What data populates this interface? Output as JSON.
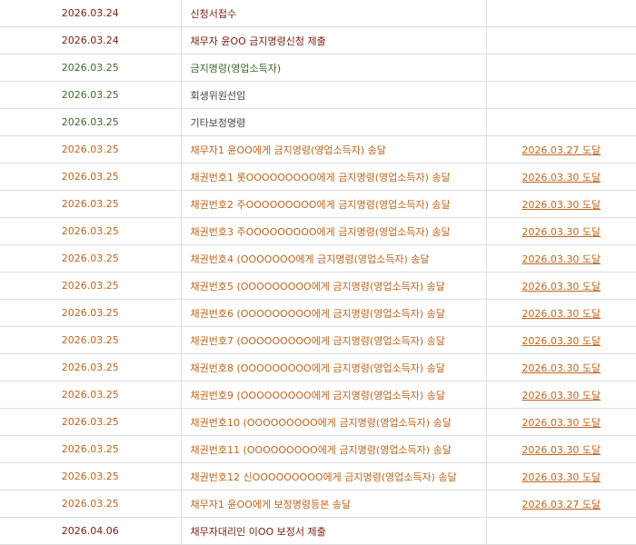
{
  "colors": {
    "dark_red": "#7a1e12",
    "green": "#3d6b2a",
    "gray_text": "#444444",
    "orange": "#c0651c",
    "border": "#dedede"
  },
  "rows": [
    {
      "date": "2026.03.24",
      "content": "신청서접수",
      "result": "",
      "style": "dark"
    },
    {
      "date": "2026.03.24",
      "content": "채무자 윤OO 금지명령신청 제출",
      "result": "",
      "style": "dark"
    },
    {
      "date": "2026.03.25",
      "content": "금지명령(영업소득자)",
      "result": "",
      "style": "green"
    },
    {
      "date": "2026.03.25",
      "content": "회생위원선임",
      "result": "",
      "style": "gray"
    },
    {
      "date": "2026.03.25",
      "content": "기타보정명령",
      "result": "",
      "style": "gray"
    },
    {
      "date": "2026.03.25",
      "content": "채무자1 윤OO에게 금지명령(영업소득자) 송달",
      "result": "2026.03.27 도달",
      "style": "orange"
    },
    {
      "date": "2026.03.25",
      "content": "채권번호1 롯OOOOOOOOO에게 금지명령(영업소득자) 송달",
      "result": "2026.03.30 도달",
      "style": "orange"
    },
    {
      "date": "2026.03.25",
      "content": "채권번호2 주OOOOOOOOO에게 금지명령(영업소득자) 송달",
      "result": "2026.03.30 도달",
      "style": "orange"
    },
    {
      "date": "2026.03.25",
      "content": "채권번호3 주OOOOOOOOO에게 금지명령(영업소득자) 송달",
      "result": "2026.03.30 도달",
      "style": "orange"
    },
    {
      "date": "2026.03.25",
      "content": "채권번호4 (OOOOOOO에게 금지명령(영업소득자) 송달",
      "result": "2026.03.30 도달",
      "style": "orange"
    },
    {
      "date": "2026.03.25",
      "content": "채권번호5 (OOOOOOOOO에게 금지명령(영업소득자) 송달",
      "result": "2026.03.30 도달",
      "style": "orange"
    },
    {
      "date": "2026.03.25",
      "content": "채권번호6 (OOOOOOOOO에게 금지명령(영업소득자) 송달",
      "result": "2026.03.30 도달",
      "style": "orange"
    },
    {
      "date": "2026.03.25",
      "content": "채권번호7 (OOOOOOOOO에게 금지명령(영업소득자) 송달",
      "result": "2026.03.30 도달",
      "style": "orange"
    },
    {
      "date": "2026.03.25",
      "content": "채권번호8 (OOOOOOOOO에게 금지명령(영업소득자) 송달",
      "result": "2026.03.30 도달",
      "style": "orange"
    },
    {
      "date": "2026.03.25",
      "content": "채권번호9 (OOOOOOOOO에게 금지명령(영업소득자) 송달",
      "result": "2026.03.30 도달",
      "style": "orange"
    },
    {
      "date": "2026.03.25",
      "content": "채권번호10 (OOOOOOOOO에게 금지명령(영업소득자) 송달",
      "result": "2026.03.30 도달",
      "style": "orange"
    },
    {
      "date": "2026.03.25",
      "content": "채권번호11 (OOOOOOOOO에게 금지명령(영업소득자) 송달",
      "result": "2026.03.30 도달",
      "style": "orange"
    },
    {
      "date": "2026.03.25",
      "content": "채권번호12 신OOOOOOOOO에게 금지명령(영업소득자) 송달",
      "result": "2026.03.30 도달",
      "style": "orange"
    },
    {
      "date": "2026.03.25",
      "content": "채무자1 윤OO에게 보정명령등본 송달",
      "result": "2026.03.27 도달",
      "style": "orange"
    },
    {
      "date": "2026.04.06",
      "content": "채무자대리인 이OO 보정서 제출",
      "result": "",
      "style": "dark"
    }
  ]
}
